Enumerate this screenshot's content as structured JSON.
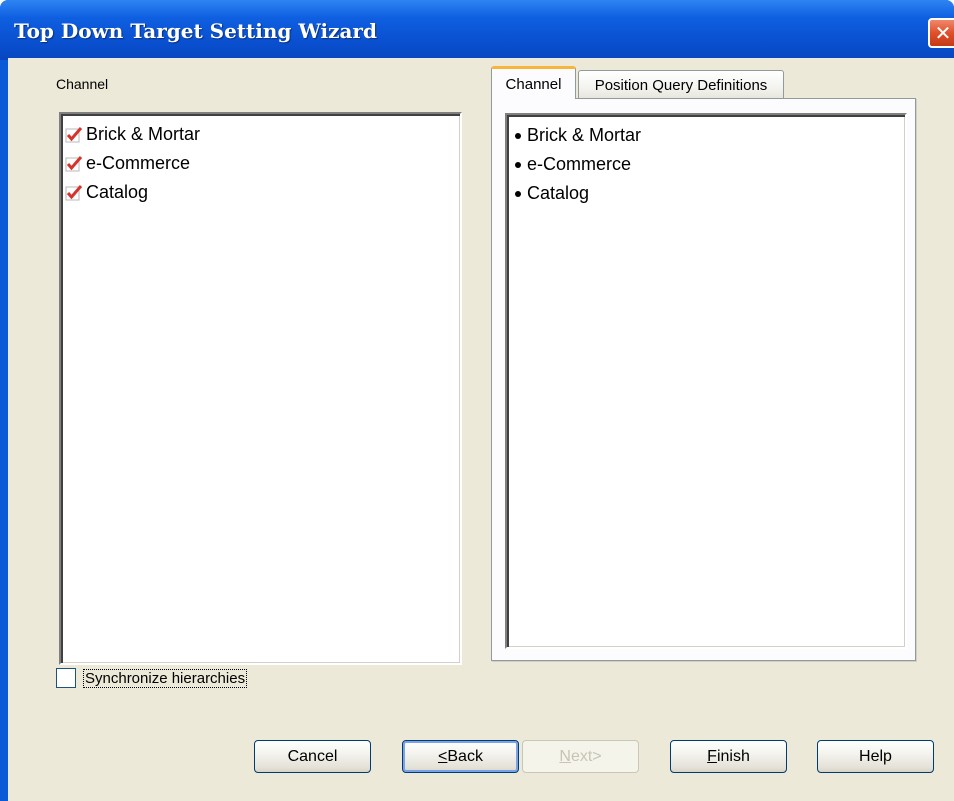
{
  "window": {
    "title": "Top Down Target Setting Wizard",
    "close_glyph": "✕"
  },
  "left_panel": {
    "label": "Channel",
    "items": [
      {
        "label": "Brick & Mortar",
        "checked": true
      },
      {
        "label": "e-Commerce",
        "checked": true
      },
      {
        "label": "Catalog",
        "checked": true
      }
    ]
  },
  "tabs": [
    {
      "label": "Channel",
      "active": true
    },
    {
      "label": "Position Query Definitions",
      "active": false
    }
  ],
  "right_panel": {
    "items": [
      {
        "label": "Brick & Mortar"
      },
      {
        "label": "e-Commerce"
      },
      {
        "label": "Catalog"
      }
    ]
  },
  "sync": {
    "label": "Synchronize hierarchies",
    "checked": false
  },
  "buttons": {
    "cancel": "Cancel",
    "back_mnemonic": "<",
    "back_rest": "Back",
    "next_mnemonic": "N",
    "next_rest": "ext>",
    "finish_mnemonic": "F",
    "finish_rest": "inish",
    "help": "Help"
  },
  "colors": {
    "titlebar": "#0a5ad8",
    "client_bg": "#ece9d8",
    "check_mark": "#d6332b",
    "tab_highlight": "#f7b53b"
  },
  "icons": {
    "close": "close-icon",
    "check": "checkmark-icon",
    "bullet": "bullet-icon"
  }
}
